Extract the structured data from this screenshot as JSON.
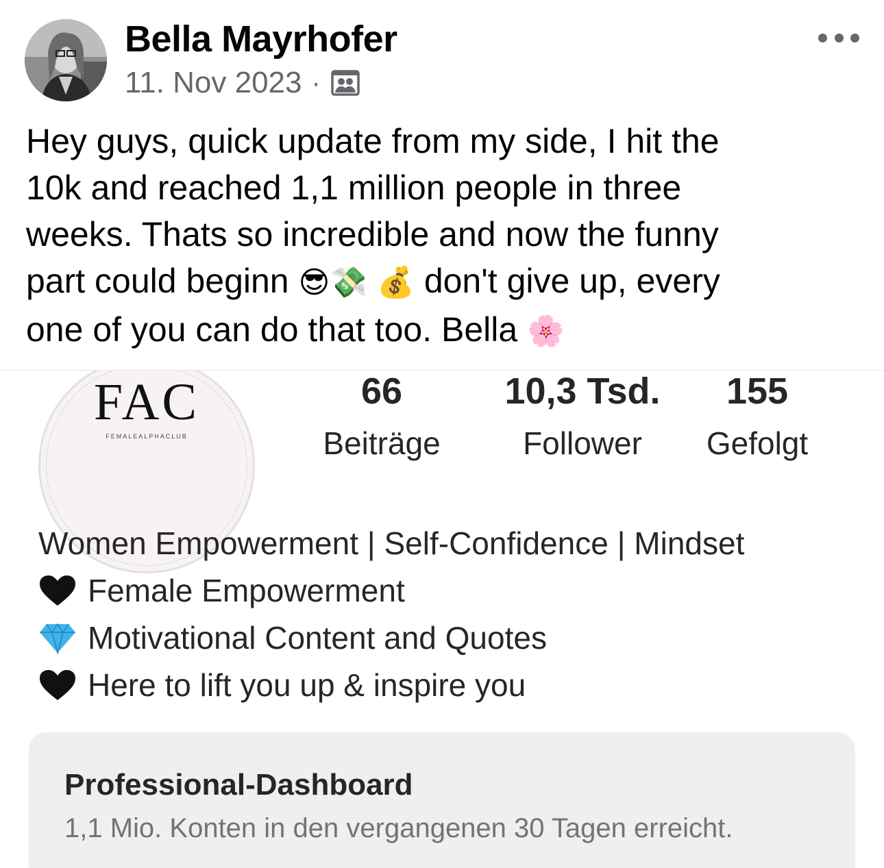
{
  "post": {
    "author": "Bella Mayrhofer",
    "date": "11. Nov 2023",
    "separator": "·",
    "audience_icon": "group-audience-icon",
    "text_lines": [
      "Hey guys, quick update from my side, I hit the",
      "10k and reached 1,1 million people in three",
      "weeks. Thats so incredible and now the funny",
      "part could beginn",
      "don't give up, every",
      "one of you can do that too. Bella"
    ],
    "emojis": {
      "sunglasses": "😎",
      "money_wings": "💸",
      "money_bag": "💰",
      "blossom": "🌸"
    }
  },
  "profile": {
    "logo_title": "FAC",
    "logo_subtitle": "FEMALEALPHACLUB",
    "stats": [
      {
        "value": "66",
        "label": "Beiträge"
      },
      {
        "value": "10,3 Tsd.",
        "label": "Follower"
      },
      {
        "value": "155",
        "label": "Gefolgt"
      }
    ],
    "bio": {
      "line1": "Women Empowerment | Self-Confidence | Mindset",
      "line2": "Female Empowerment",
      "line3": "Motivational Content and Quotes",
      "line4": "Here to lift you up & inspire you"
    },
    "dashboard": {
      "title": "Professional-Dashboard",
      "subtitle": "1,1 Mio. Konten in den vergangenen 30 Tagen erreicht."
    }
  },
  "colors": {
    "text": "#050505",
    "meta": "#65676b",
    "ig_text": "#262626",
    "ig_muted": "#737373",
    "dashboard_bg": "#efefef",
    "diamond": "#3fb4e8"
  }
}
